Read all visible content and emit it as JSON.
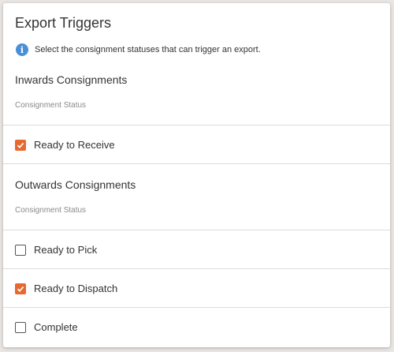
{
  "dialog": {
    "title": "Export Triggers",
    "info_text": "Select the consignment statuses that can trigger an export."
  },
  "inwards": {
    "heading": "Inwards Consignments",
    "field_label": "Consignment Status",
    "options": [
      {
        "label": "Ready to Receive",
        "checked": true
      }
    ]
  },
  "outwards": {
    "heading": "Outwards Consignments",
    "field_label": "Consignment Status",
    "options": [
      {
        "label": "Ready to Pick",
        "checked": false
      },
      {
        "label": "Ready to Dispatch",
        "checked": true
      },
      {
        "label": "Complete",
        "checked": false
      }
    ]
  },
  "colors": {
    "accent": "#e8692f",
    "info": "#4a90d9"
  }
}
